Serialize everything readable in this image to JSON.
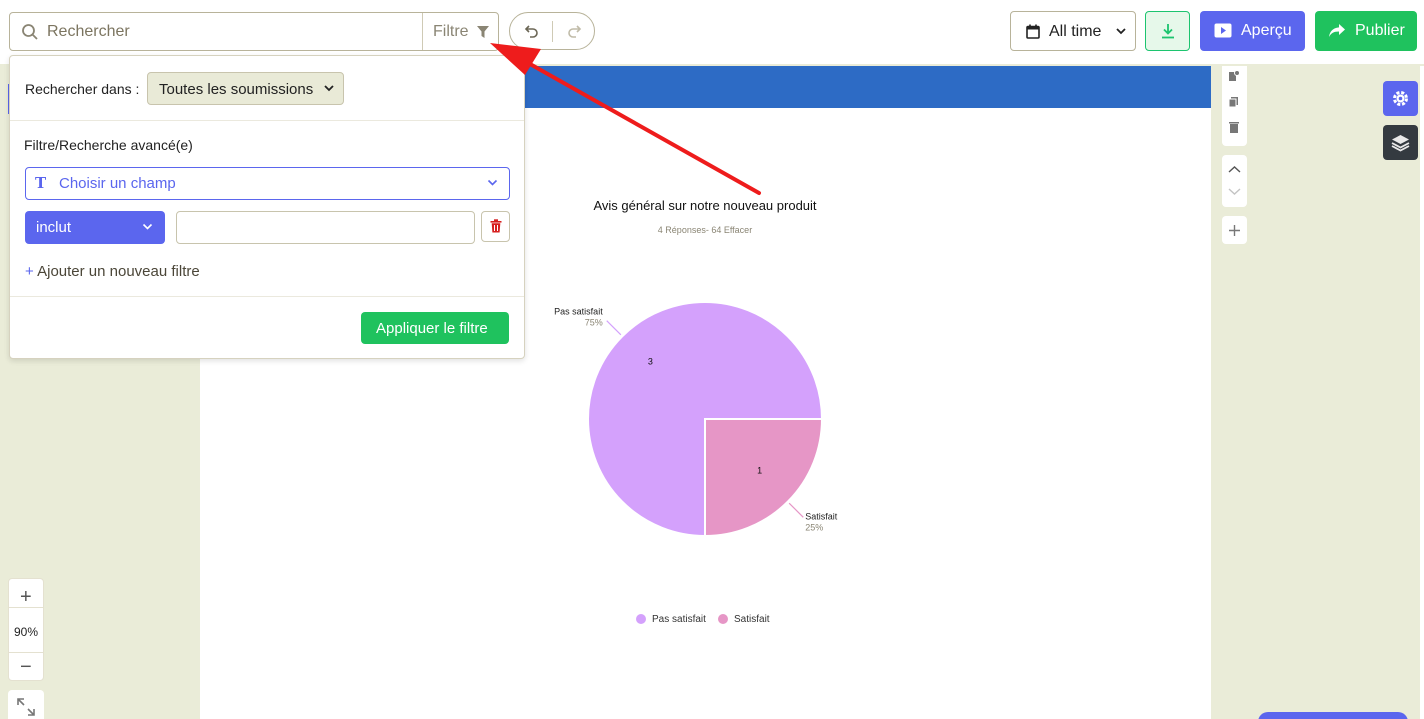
{
  "toolbar": {
    "search_placeholder": "Rechercher",
    "filter_label": "Filtre",
    "date_range": "All time",
    "preview_label": "Aperçu",
    "publish_label": "Publier"
  },
  "filter_panel": {
    "search_in_label": "Rechercher dans :",
    "search_in_value": "Toutes les soumissions",
    "advanced_label": "Filtre/Recherche avancé(e)",
    "field_placeholder": "Choisir un champ",
    "operator": "inclut",
    "value": "",
    "add_filter": "Ajouter un nouveau filtre",
    "apply_button": "Appliquer le filtre"
  },
  "zoom": {
    "level": "90%"
  },
  "colors": {
    "accent": "#5b66ee",
    "success": "#1fc25e",
    "banner": "#2d6bc5",
    "slice_pas_satisfait": "#d4a1fc",
    "slice_satisfait": "#e696c6"
  },
  "chart_data": {
    "type": "pie",
    "title": "Avis général sur notre nouveau produit",
    "subtitle": "4 Réponses- 64 Effacer",
    "categories": [
      "Pas satisfait",
      "Satisfait"
    ],
    "values": [
      3,
      1
    ],
    "percent_labels": [
      "75%",
      "25%"
    ],
    "legend": [
      "Pas satisfait",
      "Satisfait"
    ],
    "legend_position": "bottom"
  }
}
